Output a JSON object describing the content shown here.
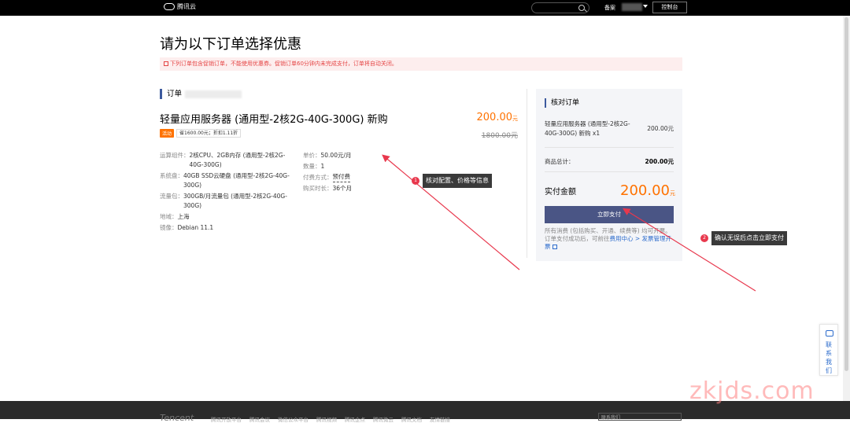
{
  "topbar": {
    "logo_text": "腾讯云",
    "beian": "备案",
    "console": "控制台"
  },
  "page": {
    "title": "请为以下订单选择优惠",
    "notice": "下列订单包含促销订单，不能使用优惠券。促销订单60分钟内未完成支付，订单将自动关闭。"
  },
  "order": {
    "section_label": "订单",
    "product_name": "轻量应用服务器 (通用型-2核2G-40G-300G) 新购",
    "price": "200.00",
    "price_unit": "元",
    "tag_activity": "活动",
    "tag_save": "省1600.00元；折扣1.11折",
    "original_price": "1800.00",
    "original_unit": "元",
    "specs": [
      {
        "k": "运算组件：",
        "v": "2核CPU、2GB内存 (通用型-2核2G-40G-300G)"
      },
      {
        "k": "系统盘：",
        "v": "40GB SSD云硬盘 (通用型-2核2G-40G-300G)"
      },
      {
        "k": "流量包：",
        "v": "300GB/月流量包 (通用型-2核2G-40G-300G)"
      },
      {
        "k": "地域：",
        "v": "上海"
      },
      {
        "k": "镜像：",
        "v": "Debian 11.1"
      }
    ],
    "specs2": [
      {
        "k": "单价：",
        "v": "50.00元/月"
      },
      {
        "k": "数量：",
        "v": "1"
      },
      {
        "k": "付费方式：",
        "v": "预付费"
      },
      {
        "k": "购买时长：",
        "v": "36个月"
      }
    ]
  },
  "checkout": {
    "title": "核对订单",
    "item_name": "轻量应用服务器 (通用型-2核2G-40G-300G) 新购 x1",
    "item_price": "200.00元",
    "subtotal_label": "商品总计：",
    "subtotal_value": "200.00元",
    "total_label": "实付金额",
    "total_price": "200.00",
    "total_unit": "元",
    "pay_button": "立即支付",
    "note_prefix": "所有消费 (包括购买、开通、续费等) 均可开票。订单支付成功后，可前往",
    "note_link": "费用中心 > 发票管理开票"
  },
  "annotations": [
    {
      "num": "1",
      "text": "核对配置、价格等信息"
    },
    {
      "num": "2",
      "text": "确认无误后点击立即支付"
    }
  ],
  "contact": "联系我们",
  "footer": {
    "logo": "Tencent",
    "links": [
      "腾讯开放平台",
      "腾讯会议",
      "微信公众平台",
      "腾讯视频",
      "腾讯企点",
      "腾讯微云",
      "腾讯文档",
      "友情链接"
    ],
    "box_text": "联系我们"
  },
  "watermark": "zkjds.com",
  "colors": {
    "accent": "#ff7200",
    "primary": "#4a5585",
    "annotation": "#e8384d"
  }
}
